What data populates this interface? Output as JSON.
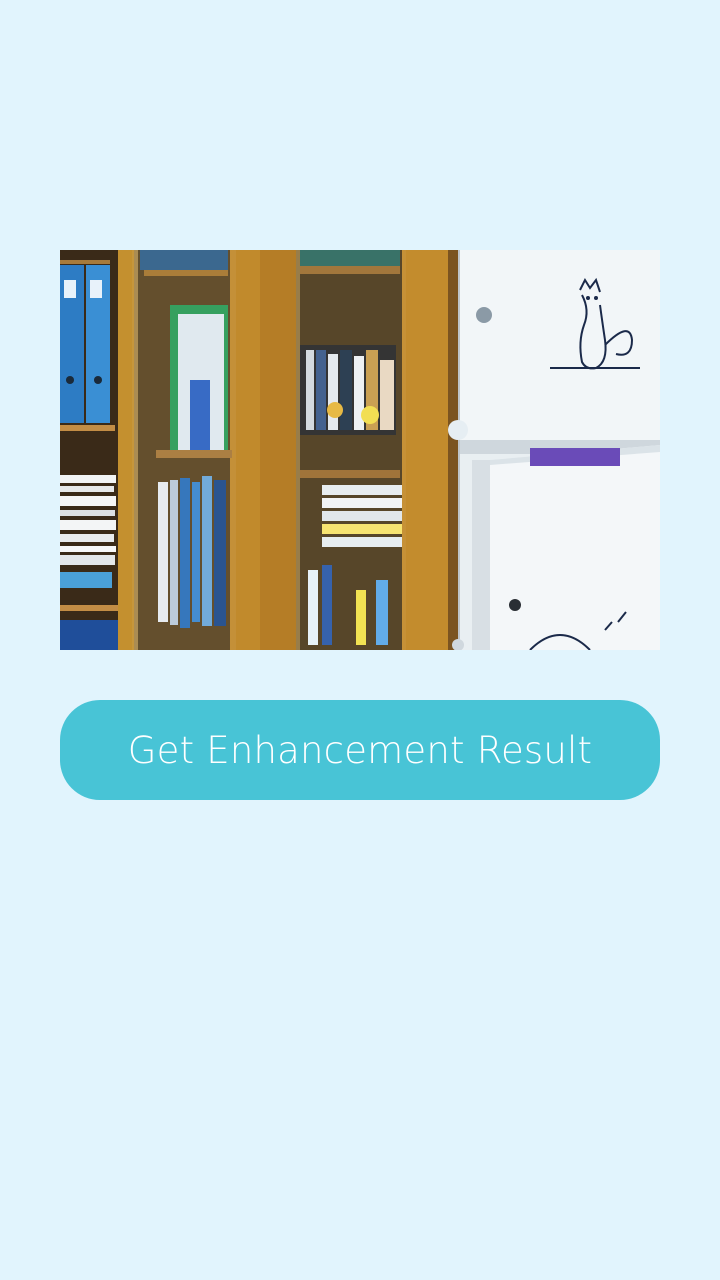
{
  "main": {
    "image_alt": "photo",
    "enhance_button_label": "Get Enhancement Result"
  },
  "colors": {
    "background": "#e1f4fd",
    "button": "#48c4d6",
    "button_text": "#ffffff"
  }
}
